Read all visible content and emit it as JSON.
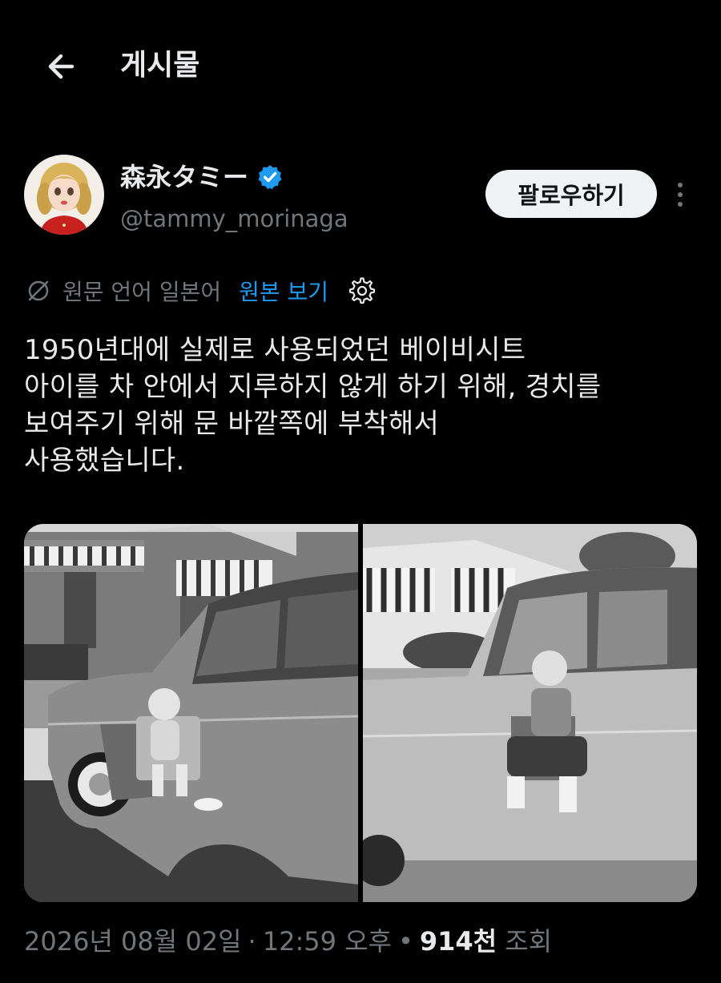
{
  "header": {
    "title": "게시물"
  },
  "author": {
    "display_name": "森永タミー",
    "handle": "@tammy_morinaga",
    "follow_label": "팔로우하기",
    "verified_color": "#1d9bf0"
  },
  "translation": {
    "original_language": "원문 언어 일본어",
    "show_original_label": "원본 보기"
  },
  "tweet": {
    "text": "1950년대에 실제로 사용되었던 베이비시트\n아이를 차 안에서 지루하지 않게 하기 위해, 경치를\n보여주기 위해 문 바깥쪽에 부착해서\n사용했습니다."
  },
  "meta": {
    "date": "2026년 08월 02일",
    "time": "12:59 오후",
    "views_count": "914천",
    "views_label": "조회"
  },
  "colors": {
    "background": "#000000",
    "text": "#e7e9ea",
    "secondary": "#71767b",
    "accent": "#1d9bf0"
  }
}
